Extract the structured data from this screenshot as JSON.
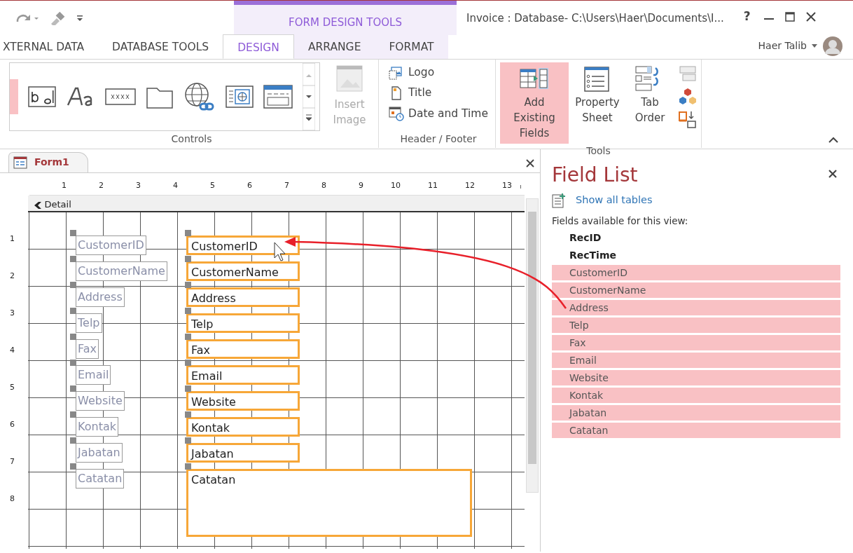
{
  "window": {
    "title": "Invoice : Database- C:\\Users\\Haer\\Documents\\I...",
    "user": "Haer Talib",
    "help": "?",
    "context_header": "FORM DESIGN TOOLS"
  },
  "tabs": [
    {
      "label": "XTERNAL DATA",
      "selected": false
    },
    {
      "label": "DATABASE TOOLS",
      "selected": false
    },
    {
      "label": "DESIGN",
      "selected": true
    },
    {
      "label": "ARRANGE",
      "selected": false
    },
    {
      "label": "FORMAT",
      "selected": false
    }
  ],
  "ribbon": {
    "groups": [
      {
        "label": "Controls",
        "kind": "controls",
        "items": [
          {
            "label": "Insert Image",
            "disabled": true
          }
        ]
      },
      {
        "label": "Header / Footer",
        "kind": "list",
        "items": [
          {
            "label": "Logo",
            "disabled": false
          },
          {
            "label": "Title",
            "disabled": false
          },
          {
            "label": "Date and Time",
            "disabled": false
          }
        ]
      },
      {
        "label": "Tools",
        "kind": "big",
        "items": [
          {
            "label": "Add Existing Fields",
            "selected": true
          },
          {
            "label": "Property Sheet",
            "selected": false
          },
          {
            "label": "Tab Order",
            "selected": false
          }
        ]
      }
    ]
  },
  "document_tab": {
    "label": "Form1"
  },
  "ruler": {
    "horizontal": [
      "1",
      "2",
      "3",
      "4",
      "5",
      "6",
      "7",
      "8",
      "9",
      "10",
      "11",
      "12",
      "13"
    ],
    "vertical": [
      "1",
      "2",
      "3",
      "4",
      "5",
      "6",
      "7",
      "8"
    ]
  },
  "section": {
    "label": "Detail"
  },
  "form_controls": [
    {
      "label": "CustomerID",
      "field": "CustomerID",
      "kind": "text",
      "selected": true
    },
    {
      "label": "CustomerName",
      "field": "CustomerName",
      "kind": "text",
      "selected": true
    },
    {
      "label": "Address",
      "field": "Address",
      "kind": "text",
      "selected": true
    },
    {
      "label": "Telp",
      "field": "Telp",
      "kind": "text",
      "selected": true
    },
    {
      "label": "Fax",
      "field": "Fax",
      "kind": "text",
      "selected": true
    },
    {
      "label": "Email",
      "field": "Email",
      "kind": "text",
      "selected": true
    },
    {
      "label": "Website",
      "field": "Website",
      "kind": "text",
      "selected": true
    },
    {
      "label": "Kontak",
      "field": "Kontak",
      "kind": "text",
      "selected": true
    },
    {
      "label": "Jabatan",
      "field": "Jabatan",
      "kind": "text",
      "selected": true
    },
    {
      "label": "Catatan",
      "field": "Catatan",
      "kind": "memo",
      "selected": true
    }
  ],
  "field_list": {
    "title": "Field List",
    "link": "Show all tables",
    "caption": "Fields available for this view:",
    "fields": [
      {
        "label": "RecID",
        "selected": false
      },
      {
        "label": "RecTime",
        "selected": false
      },
      {
        "label": "CustomerID",
        "selected": true
      },
      {
        "label": "CustomerName",
        "selected": true
      },
      {
        "label": "Address",
        "selected": true
      },
      {
        "label": "Telp",
        "selected": true
      },
      {
        "label": "Fax",
        "selected": true
      },
      {
        "label": "Email",
        "selected": true
      },
      {
        "label": "Website",
        "selected": true
      },
      {
        "label": "Kontak",
        "selected": true
      },
      {
        "label": "Jabatan",
        "selected": true
      },
      {
        "label": "Catatan",
        "selected": true
      }
    ]
  }
}
